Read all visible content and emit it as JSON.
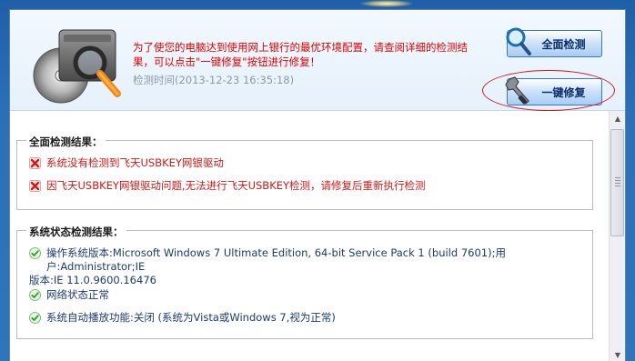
{
  "header": {
    "message": "为了使您的电脑达到使用网上银行的最优环境配置，请查阅详细的检测结果，可以点击\"一键修复\"按钮进行修复！",
    "check_time": "检测时间(2013-12-23 16:35:18)"
  },
  "buttons": {
    "full_check": "全面检测",
    "one_click_fix": "一键修复"
  },
  "full_results": {
    "title": "全面检测结果：",
    "items": [
      {
        "status": "error",
        "icon": "red-x-icon",
        "text": "系统没有检测到飞天USBKEY网银驱动"
      },
      {
        "status": "error",
        "icon": "red-x-icon",
        "text": "因飞天USBKEY网银驱动问题,无法进行飞天USBKEY检测，请修复后重新执行检测"
      }
    ]
  },
  "system_status": {
    "title": "系统状态检测结果：",
    "items": [
      {
        "status": "info",
        "icon": "green-check-icon",
        "line1": "操作系统版本:Microsoft Windows 7 Ultimate Edition, 64-bit Service Pack 1 (build 7601);用户:Administrator;IE",
        "line2": "版本:IE 11.0.9600.16476"
      },
      {
        "status": "ok",
        "icon": "green-check-icon",
        "text": "网络状态正常"
      },
      {
        "status": "ok",
        "icon": "green-check-icon",
        "text": "系统自动播放功能:关闭 (系统为Vista或Windows 7,视为正常)"
      }
    ]
  },
  "colors": {
    "error_text": "#d01818",
    "info_text": "#1d3b73",
    "ok_text": "#2e8b2e",
    "button_text": "#0b2d6b",
    "annotation_ellipse": "#d01818"
  }
}
